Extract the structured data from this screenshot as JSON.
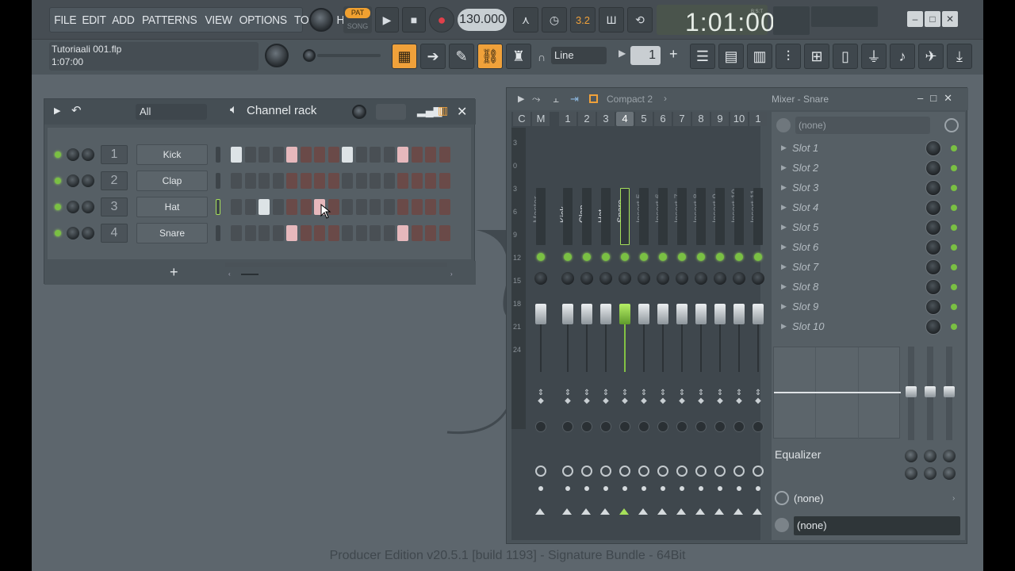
{
  "menu": [
    "FILE",
    "EDIT",
    "ADD",
    "PATTERNS",
    "VIEW",
    "OPTIONS",
    "TOOLS",
    "HELP"
  ],
  "transport": {
    "pat": "PAT",
    "song": "SONG",
    "tempo": "130.000",
    "time": "1:01:00",
    "bst": "B:S:T",
    "step_label": "3.2"
  },
  "project": {
    "name": "Tutoriaali 001.flp",
    "time": "1:07:00"
  },
  "toolbar": {
    "snap_mode": "Line",
    "snap_value": "1"
  },
  "channel_rack": {
    "filter": "All",
    "title": "Channel rack",
    "channels": [
      {
        "num": "1",
        "name": "Kick",
        "steps": [
          1,
          0,
          0,
          0,
          1,
          0,
          0,
          0,
          1,
          0,
          0,
          0,
          1,
          0,
          0,
          0
        ]
      },
      {
        "num": "2",
        "name": "Clap",
        "steps": [
          0,
          0,
          0,
          0,
          0,
          0,
          0,
          0,
          0,
          0,
          0,
          0,
          0,
          0,
          0,
          0
        ]
      },
      {
        "num": "3",
        "name": "Hat",
        "steps": [
          0,
          0,
          1,
          0,
          0,
          0,
          1,
          0,
          0,
          0,
          0,
          0,
          0,
          0,
          0,
          0
        ]
      },
      {
        "num": "4",
        "name": "Snare",
        "steps": [
          0,
          0,
          0,
          0,
          1,
          0,
          0,
          0,
          0,
          0,
          0,
          0,
          1,
          0,
          0,
          0
        ]
      }
    ],
    "add": "+"
  },
  "mixer": {
    "preset": "Compact 2",
    "title": "Mixer - Snare",
    "track_labels": [
      "C",
      "M",
      "1",
      "2",
      "3",
      "4",
      "5",
      "6",
      "7",
      "8",
      "9",
      "10",
      "1"
    ],
    "tracks": [
      "Master",
      "Kick",
      "Clap",
      "Hat",
      "Snare",
      "Insert 5",
      "Insert 6",
      "Insert 7",
      "Insert 8",
      "Insert 9",
      "Insert 10",
      "Insert 11"
    ],
    "db_scale": [
      "3",
      "0",
      "3",
      "6",
      "9",
      "12",
      "15",
      "18",
      "21",
      "24"
    ],
    "input": "(none)",
    "slots": [
      "Slot 1",
      "Slot 2",
      "Slot 3",
      "Slot 4",
      "Slot 5",
      "Slot 6",
      "Slot 7",
      "Slot 8",
      "Slot 9",
      "Slot 10"
    ],
    "eq_label": "Equalizer",
    "output1": "(none)",
    "output2": "(none)"
  },
  "status": "Producer Edition v20.5.1 [build 1193] - Signature Bundle - 64Bit",
  "colors": {
    "accent": "#f0a13a",
    "led": "#7ac043",
    "step_on": "#e6b8bc"
  }
}
